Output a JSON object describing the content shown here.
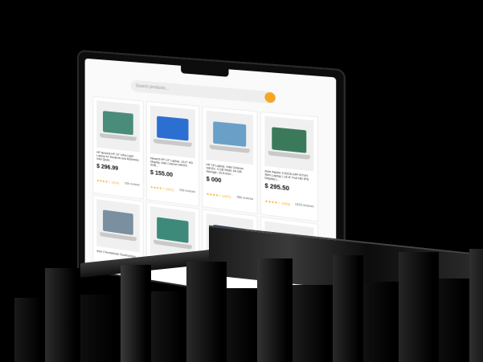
{
  "search": {
    "placeholder": "Search products..."
  },
  "products": [
    {
      "title": "HP Newest HP 14\" Ultra Light Laptop for Students and Business, Intel Quad...",
      "price": "$ 296.99",
      "rating": "(513)",
      "reviews": "536 reviews",
      "screen_color": "#4a8c7a"
    },
    {
      "title": "Newest HP 14\" Laptop, 14.0\" HD Display, Intel Celeron N4020, 4GB...",
      "price": "$ 155.00",
      "rating": "(431)",
      "reviews": "538 reviews",
      "screen_color": "#2b6fd1"
    },
    {
      "title": "HP 15 Laptop, Intel Celeron N4020, 4 GB RAM, 64 GB Storage, 15.6-inch...",
      "price": "$ 000",
      "rating": "(437)",
      "reviews": "586 reviews",
      "screen_color": "#6aa0c8"
    },
    {
      "title": "Acer Aspire 3 A315-24P-R7VH Slim Laptop | 15.6\" Full HD IPS Display |...",
      "price": "$ 295.50",
      "rating": "(453)",
      "reviews": "1526 reviews",
      "screen_color": "#3a7a5a"
    },
    {
      "title": "Acer Chromebook Touchscreen...",
      "price": "",
      "rating": "",
      "reviews": "",
      "screen_color": "#7a8fa0"
    },
    {
      "title": "",
      "price": "",
      "rating": "",
      "reviews": "",
      "screen_color": "#3d8a7a"
    },
    {
      "title": "",
      "price": "",
      "rating": "",
      "reviews": "",
      "screen_color": "#2a4a6a"
    },
    {
      "title": "",
      "price": "",
      "rating": "",
      "reviews": "",
      "screen_color": "#c04a3a"
    }
  ],
  "stars": "★★★★☆"
}
